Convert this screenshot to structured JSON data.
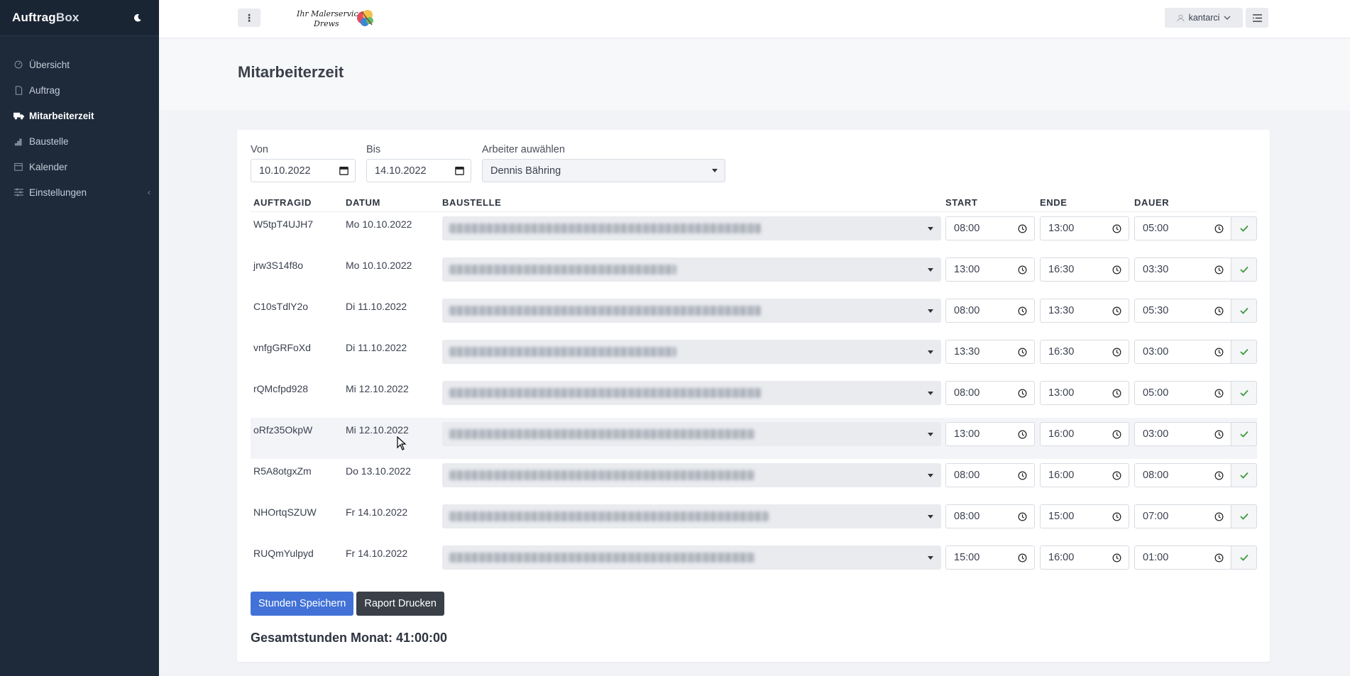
{
  "app": {
    "brand_bold": "Auftrag",
    "brand_thin": "Box"
  },
  "sidebar": {
    "items": [
      {
        "label": "Übersicht",
        "icon": "dashboard-icon"
      },
      {
        "label": "Auftrag",
        "icon": "document-icon"
      },
      {
        "label": "Mitarbeiterzeit",
        "icon": "truck-icon",
        "active": true
      },
      {
        "label": "Baustelle",
        "icon": "stairs-icon"
      },
      {
        "label": "Kalender",
        "icon": "calendar-icon"
      },
      {
        "label": "Einstellungen",
        "icon": "sliders-icon"
      }
    ]
  },
  "topbar": {
    "user": "kantarci",
    "logo_line1": "Ihr Malerservice",
    "logo_line2": "Drews"
  },
  "page": {
    "title": "Mitarbeiterzeit"
  },
  "filters": {
    "from_label": "Von",
    "from_value": "10.10.2022",
    "to_label": "Bis",
    "to_value": "14.10.2022",
    "worker_label": "Arbeiter auwählen",
    "worker_value": "Dennis Bähring"
  },
  "table": {
    "headers": {
      "id": "AUFTRAGID",
      "date": "DATUM",
      "site": "BAUSTELLE",
      "start": "START",
      "end": "ENDE",
      "duration": "DAUER"
    },
    "rows": [
      {
        "id": "W5tpT4UJH7",
        "date": "Mo 10.10.2022",
        "start": "08:00",
        "end": "13:00",
        "duration": "05:00"
      },
      {
        "id": "jrw3S14f8o",
        "date": "Mo 10.10.2022",
        "start": "13:00",
        "end": "16:30",
        "duration": "03:30"
      },
      {
        "id": "C10sTdlY2o",
        "date": "Di 11.10.2022",
        "start": "08:00",
        "end": "13:30",
        "duration": "05:30"
      },
      {
        "id": "vnfgGRFoXd",
        "date": "Di 11.10.2022",
        "start": "13:30",
        "end": "16:30",
        "duration": "03:00"
      },
      {
        "id": "rQMcfpd928",
        "date": "Mi 12.10.2022",
        "start": "08:00",
        "end": "13:00",
        "duration": "05:00"
      },
      {
        "id": "oRfz35OkpW",
        "date": "Mi 12.10.2022",
        "start": "13:00",
        "end": "16:00",
        "duration": "03:00"
      },
      {
        "id": "R5A8otgxZm",
        "date": "Do 13.10.2022",
        "start": "08:00",
        "end": "16:00",
        "duration": "08:00"
      },
      {
        "id": "NHOrtqSZUW",
        "date": "Fr 14.10.2022",
        "start": "08:00",
        "end": "15:00",
        "duration": "07:00"
      },
      {
        "id": "RUQmYulpyd",
        "date": "Fr 14.10.2022",
        "start": "15:00",
        "end": "16:00",
        "duration": "01:00"
      }
    ]
  },
  "actions": {
    "save": "Stunden Speichern",
    "print": "Raport Drucken"
  },
  "summary": {
    "total": "Gesamtstunden Monat: 41:00:00"
  },
  "colors": {
    "sidebar": "#1e2a3a",
    "primary": "#4272d7",
    "success": "#3c9a3c"
  }
}
